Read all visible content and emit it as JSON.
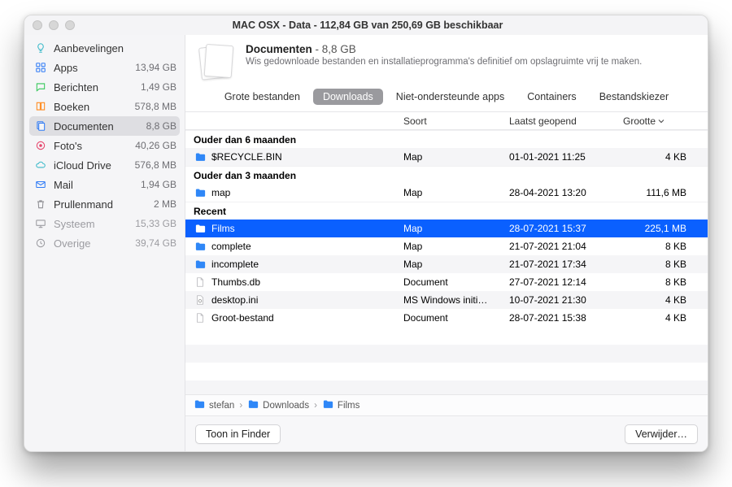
{
  "window_title": "MAC OSX - Data - 112,84 GB van 250,69 GB beschikbaar",
  "sidebar": {
    "items": [
      {
        "icon": "lightbulb",
        "label": "Aanbevelingen",
        "size": ""
      },
      {
        "icon": "apps",
        "label": "Apps",
        "size": "13,94 GB"
      },
      {
        "icon": "message",
        "label": "Berichten",
        "size": "1,49 GB"
      },
      {
        "icon": "book",
        "label": "Boeken",
        "size": "578,8 MB"
      },
      {
        "icon": "docs",
        "label": "Documenten",
        "size": "8,8 GB"
      },
      {
        "icon": "photos",
        "label": "Foto's",
        "size": "40,26 GB"
      },
      {
        "icon": "icloud",
        "label": "iCloud Drive",
        "size": "576,8 MB"
      },
      {
        "icon": "mail",
        "label": "Mail",
        "size": "1,94 GB"
      },
      {
        "icon": "trash",
        "label": "Prullenmand",
        "size": "2 MB"
      },
      {
        "icon": "system",
        "label": "Systeem",
        "size": "15,33 GB"
      },
      {
        "icon": "other",
        "label": "Overige",
        "size": "39,74 GB"
      }
    ],
    "selected_index": 4,
    "dim_from_index": 9
  },
  "summary": {
    "title": "Documenten",
    "size_suffix": " - 8,8 GB",
    "subtitle": "Wis gedownloade bestanden en installatieprogramma's definitief om opslagruimte vrij te maken."
  },
  "tabs": {
    "items": [
      "Grote bestanden",
      "Downloads",
      "Niet-ondersteunde apps",
      "Containers",
      "Bestandskiezer"
    ],
    "active_index": 1
  },
  "columns": {
    "name": "",
    "kind": "Soort",
    "opened": "Laatst geopend",
    "size": "Grootte"
  },
  "sections": [
    {
      "title": "Ouder dan 6 maanden",
      "rows": [
        {
          "icon": "folder",
          "name": "$RECYCLE.BIN",
          "kind": "Map",
          "opened": "01-01-2021 11:25",
          "size": "4 KB"
        }
      ]
    },
    {
      "title": "Ouder dan 3 maanden",
      "rows": [
        {
          "icon": "folder",
          "name": "map",
          "kind": "Map",
          "opened": "28-04-2021 13:20",
          "size": "111,6 MB"
        }
      ]
    },
    {
      "title": "Recent",
      "rows": [
        {
          "icon": "folder",
          "name": "Films",
          "kind": "Map",
          "opened": "28-07-2021 15:37",
          "size": "225,1 MB",
          "selected": true
        },
        {
          "icon": "folder",
          "name": "complete",
          "kind": "Map",
          "opened": "21-07-2021 21:04",
          "size": "8 KB"
        },
        {
          "icon": "folder",
          "name": "incomplete",
          "kind": "Map",
          "opened": "21-07-2021 17:34",
          "size": "8 KB"
        },
        {
          "icon": "file",
          "name": "Thumbs.db",
          "kind": "Document",
          "opened": "27-07-2021 12:14",
          "size": "8 KB"
        },
        {
          "icon": "ini",
          "name": "desktop.ini",
          "kind": "MS Windows initi…",
          "opened": "10-07-2021 21:30",
          "size": "4 KB"
        },
        {
          "icon": "file",
          "name": "Groot-bestand",
          "kind": "Document",
          "opened": "28-07-2021 15:38",
          "size": "4 KB"
        }
      ]
    }
  ],
  "breadcrumb": [
    "stefan",
    "Downloads",
    "Films"
  ],
  "footer": {
    "show_in_finder": "Toon in Finder",
    "delete": "Verwijder…"
  },
  "colors": {
    "accent": "#0a60ff",
    "icon_blue": "#2f7bf6",
    "icon_orange": "#ff8a1e",
    "icon_teal": "#3ab9c9",
    "icon_gray": "#8e8e93",
    "icon_green": "#34c759",
    "folder": "#2f87f7",
    "dim": "#9c9ca1"
  }
}
